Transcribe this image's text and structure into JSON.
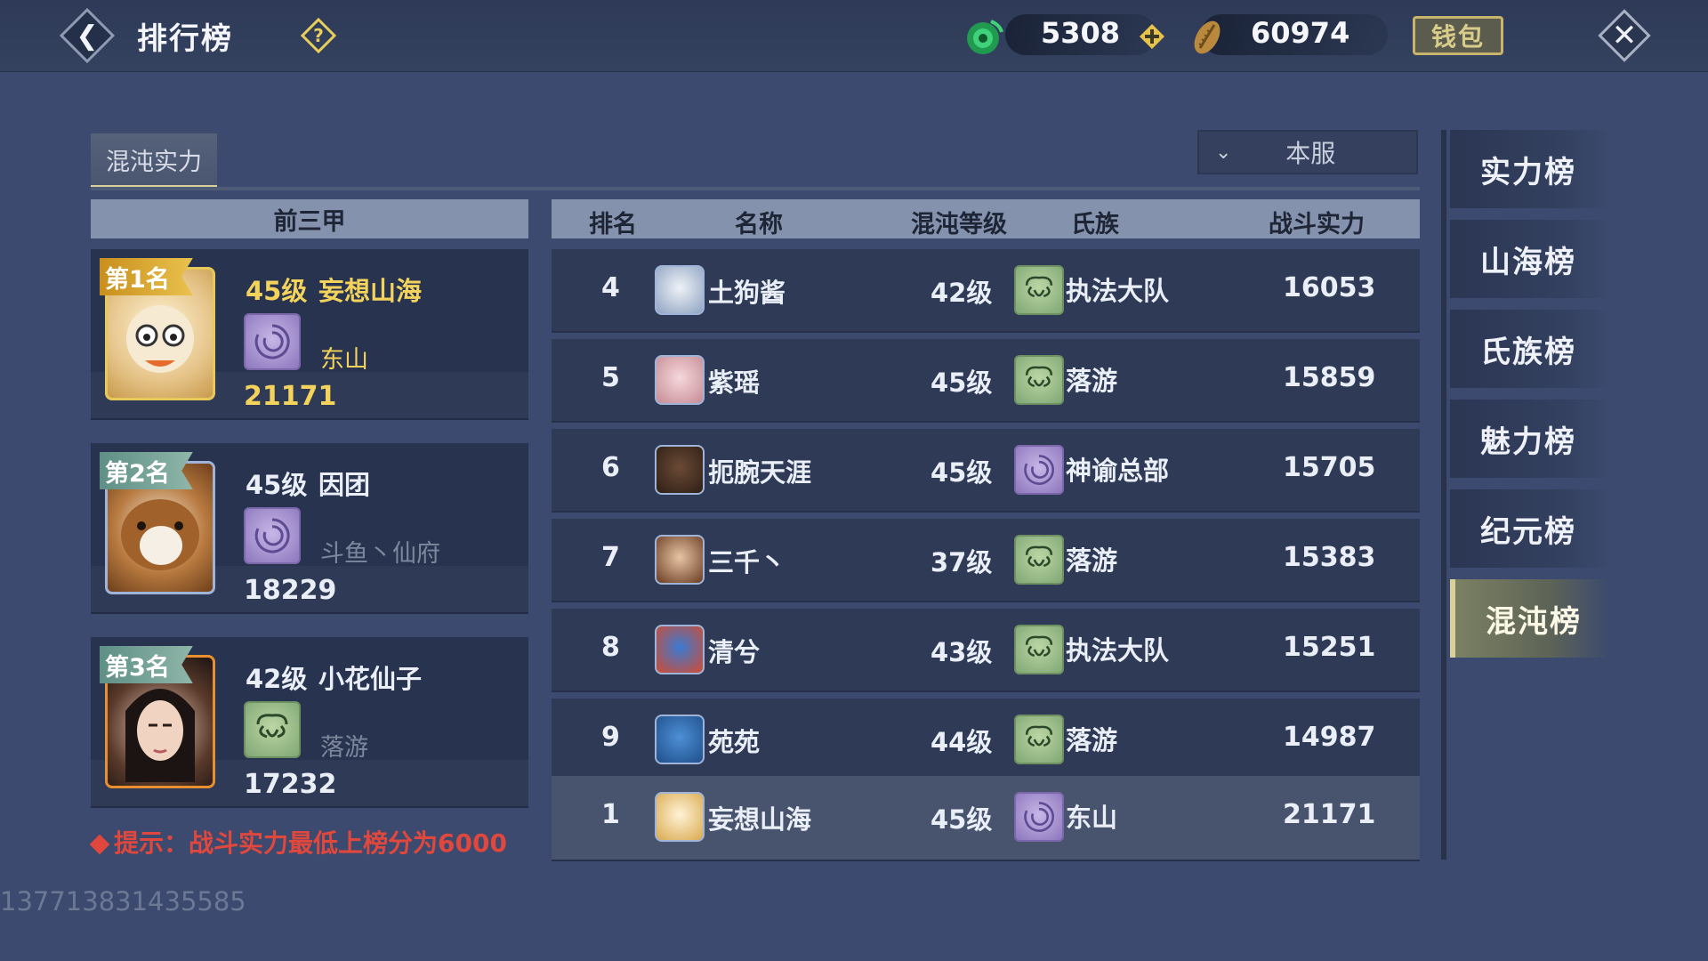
{
  "header": {
    "title": "排行榜",
    "currency1_value": "5308",
    "currency2_value": "60974",
    "wallet_label": "钱包"
  },
  "tabs": {
    "active_label": "混沌实力"
  },
  "server_filter": {
    "selected": "本服"
  },
  "top3": {
    "header": "前三甲",
    "cards": [
      {
        "rank_label": "第1名",
        "level": "45级",
        "name": "妄想山海",
        "guild": "东山",
        "power": "21171",
        "guild_color": "purple",
        "accent": "#f3d35b"
      },
      {
        "rank_label": "第2名",
        "level": "45级",
        "name": "因团",
        "guild": "斗鱼丶仙府",
        "power": "18229",
        "guild_color": "purple",
        "accent": "#ffffff"
      },
      {
        "rank_label": "第3名",
        "level": "42级",
        "name": "小花仙子",
        "guild": "落游",
        "power": "17232",
        "guild_color": "green",
        "accent": "#ffffff"
      }
    ]
  },
  "hint": "提示：战斗实力最低上榜分为6000",
  "uid": "137713831435585",
  "table": {
    "columns": [
      "排名",
      "名称",
      "混沌等级",
      "氏族",
      "战斗实力"
    ],
    "rows": [
      {
        "rank": "4",
        "name": "土狗酱",
        "level": "42级",
        "guild": "执法大队",
        "power": "16053",
        "guild_color": "green"
      },
      {
        "rank": "5",
        "name": "紫瑶",
        "level": "45级",
        "guild": "落游",
        "power": "15859",
        "guild_color": "green"
      },
      {
        "rank": "6",
        "name": "扼腕天涯",
        "level": "45级",
        "guild": "神谕总部",
        "power": "15705",
        "guild_color": "purple"
      },
      {
        "rank": "7",
        "name": "三千丶",
        "level": "37级",
        "guild": "落游",
        "power": "15383",
        "guild_color": "green"
      },
      {
        "rank": "8",
        "name": "清兮",
        "level": "43级",
        "guild": "执法大队",
        "power": "15251",
        "guild_color": "green"
      },
      {
        "rank": "9",
        "name": "苑苑",
        "level": "44级",
        "guild": "落游",
        "power": "14987",
        "guild_color": "green"
      }
    ],
    "my_row": {
      "rank": "1",
      "name": "妄想山海",
      "level": "45级",
      "guild": "东山",
      "power": "21171",
      "guild_color": "purple"
    }
  },
  "side_tabs": [
    {
      "label": "实力榜",
      "active": false
    },
    {
      "label": "山海榜",
      "active": false
    },
    {
      "label": "氏族榜",
      "active": false
    },
    {
      "label": "魅力榜",
      "active": false
    },
    {
      "label": "纪元榜",
      "active": false
    },
    {
      "label": "混沌榜",
      "active": true
    }
  ],
  "icons": {
    "back": "chevron-left-icon",
    "help": "question-diamond-icon",
    "currency1": "jade-coin-icon",
    "currency2": "shell-coin-icon",
    "add": "plus-icon",
    "close": "close-icon",
    "dropdown": "chevron-down-icon"
  }
}
